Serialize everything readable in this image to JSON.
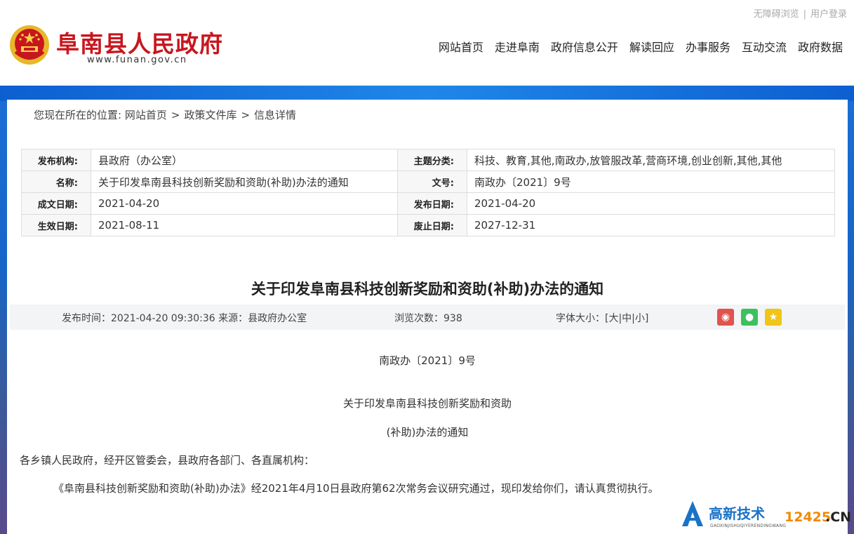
{
  "header": {
    "site_name": "阜南县人民政府",
    "site_url": "www.funan.gov.cn",
    "top_links": [
      "无障碍浏览",
      "用户登录"
    ],
    "nav": [
      "网站首页",
      "走进阜南",
      "政府信息公开",
      "解读回应",
      "办事服务",
      "互动交流",
      "政府数据"
    ]
  },
  "breadcrumb": {
    "prefix": "您现在所在的位置:",
    "items": [
      "网站首页",
      "政策文件库",
      "信息详情"
    ],
    "separator": ">"
  },
  "meta": {
    "rows": [
      {
        "k1": "发布机构:",
        "v1": "县政府（办公室）",
        "k2": "主题分类:",
        "v2": "科技、教育,其他,南政办,放管服改革,营商环境,创业创新,其他,其他"
      },
      {
        "k1": "名称:",
        "v1": "关于印发阜南县科技创新奖励和资助(补助)办法的通知",
        "k2": "文号:",
        "v2": "南政办〔2021〕9号"
      },
      {
        "k1": "成文日期:",
        "v1": "2021-04-20",
        "k2": "发布日期:",
        "v2": "2021-04-20"
      },
      {
        "k1": "生效日期:",
        "v1": "2021-08-11",
        "k2": "废止日期:",
        "v2": "2027-12-31"
      }
    ]
  },
  "article": {
    "title": "关于印发阜南县科技创新奖励和资助(补助)办法的通知",
    "publish_info": "发布时间：2021-04-20 09:30:36   来源：县政府办公室",
    "views": "浏览次数：938",
    "font_size": "字体大小：[大|中|小]",
    "doc_no": "南政办〔2021〕9号",
    "subtitle_1": "关于印发阜南县科技创新奖励和资助",
    "subtitle_2": "(补助)办法的通知",
    "para_1": "各乡镇人民政府，经开区管委会，县政府各部门、各直属机构：",
    "para_2": "《阜南县科技创新奖励和资助(补助)办法》经2021年4月10日县政府第62次常务会议研究通过，现印发给你们，请认真贯彻执行。"
  },
  "share_icons": [
    "weibo-icon",
    "wechat-icon",
    "favorite-icon"
  ],
  "watermark": {
    "name": "高新技术",
    "num": "12425",
    "cn": ".CN",
    "pinyin": "GAOXINJISHUQIYERENDINGWANG"
  },
  "colors": {
    "brand_red": "#c8161e",
    "band_blue": "#1b6fd6"
  }
}
